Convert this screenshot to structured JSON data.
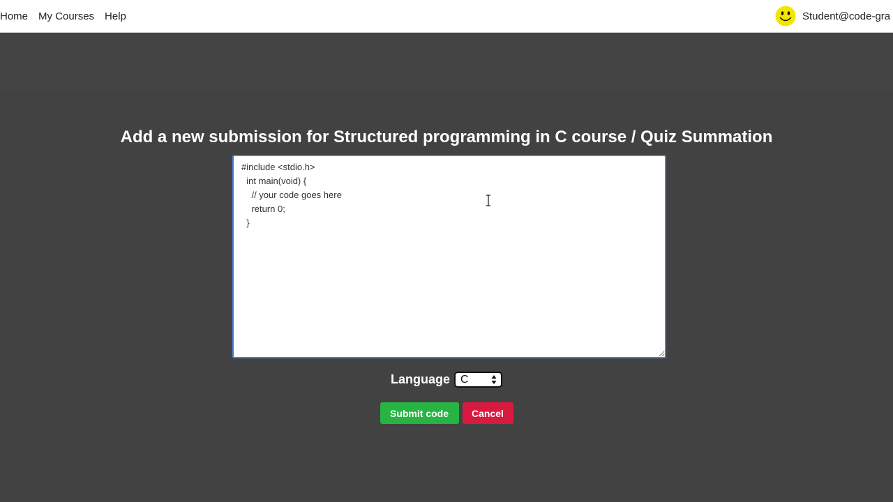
{
  "nav": {
    "links": [
      "Home",
      "My Courses",
      "Help"
    ],
    "user": "Student@code-gra"
  },
  "page": {
    "title": "Add a new submission for Structured programming in C course / Quiz Summation"
  },
  "editor": {
    "code": "#include <stdio.h>\n  int main(void) {\n    // your code goes here\n    return 0;\n  }"
  },
  "language": {
    "label": "Language",
    "selected": "C"
  },
  "buttons": {
    "submit": "Submit code",
    "cancel": "Cancel"
  },
  "colors": {
    "background": "#424242",
    "submit": "#27b443",
    "cancel": "#d81a41",
    "avatar": "#f5e600"
  }
}
